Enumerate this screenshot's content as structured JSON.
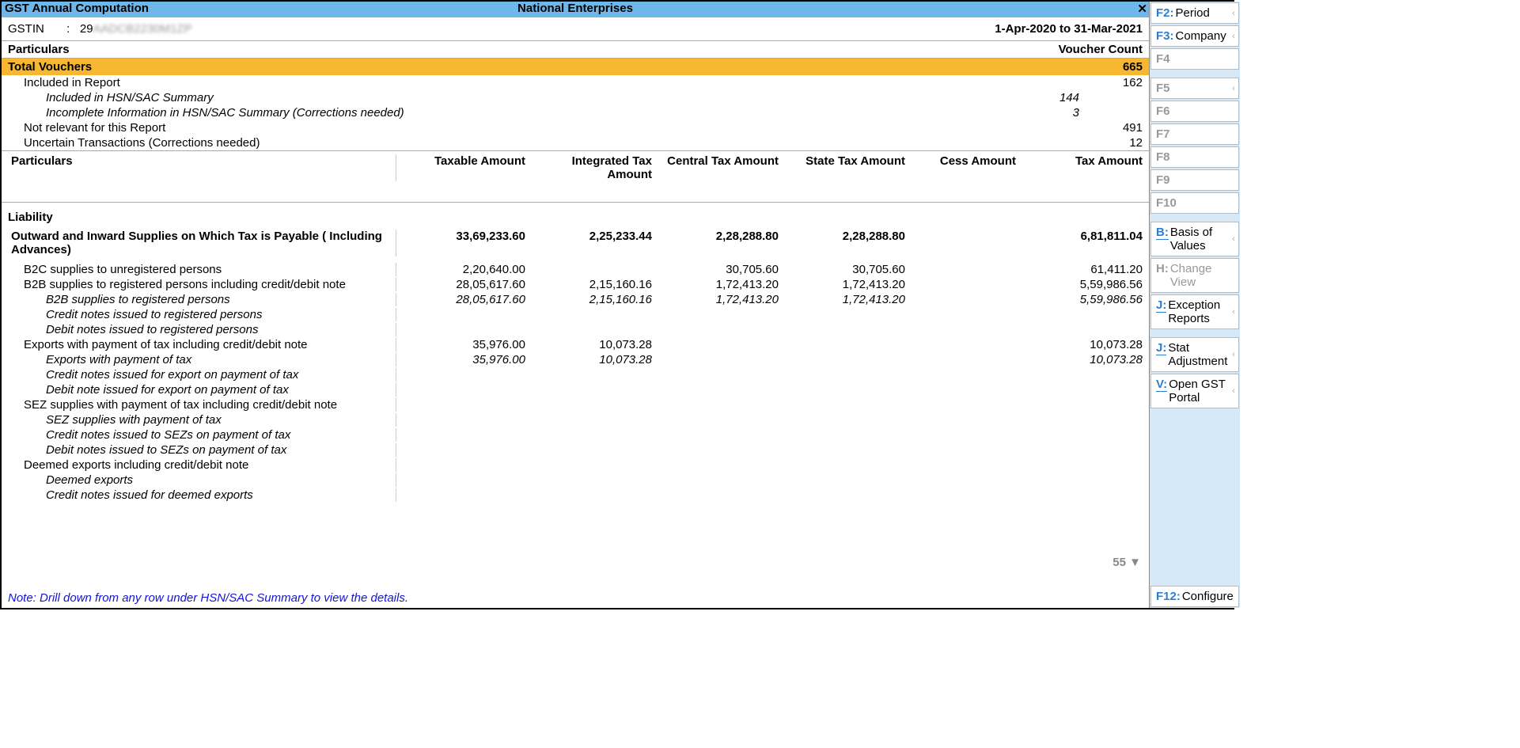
{
  "title_left": "GST Annual Computation",
  "title_center": "National Enterprises",
  "gstin_label": "GSTIN",
  "gstin_sep": ":",
  "gstin_value": "29AADCB2230M1ZP",
  "period": "1-Apr-2020 to 31-Mar-2021",
  "hdr_particulars": "Particulars",
  "hdr_vcount": "Voucher Count",
  "total_vouchers_label": "Total Vouchers",
  "total_vouchers_value": "665",
  "vrows": [
    {
      "label": "Included in Report",
      "mid": "",
      "count": "162",
      "cls": "indent1"
    },
    {
      "label": "Included in HSN/SAC Summary",
      "mid": "144",
      "count": "",
      "cls": "indent2"
    },
    {
      "label": "Incomplete Information in HSN/SAC Summary (Corrections needed)",
      "mid": "3",
      "count": "",
      "cls": "indent2"
    },
    {
      "label": "Not relevant for this Report",
      "mid": "",
      "count": "491",
      "cls": "indent1"
    },
    {
      "label": "Uncertain Transactions (Corrections needed)",
      "mid": "",
      "count": "12",
      "cls": "indent1"
    }
  ],
  "cols": {
    "part": "Particulars",
    "taxable": "Taxable Amount",
    "igst": "Integrated Tax Amount",
    "cgst": "Central Tax Amount",
    "sgst": "State Tax Amount",
    "cess": "Cess Amount",
    "total": "Tax Amount"
  },
  "section": "Liability",
  "data_rows": [
    {
      "label": "Outward and Inward Supplies on Which Tax is Payable ( Including Advances)",
      "taxable": "33,69,233.60",
      "igst": "2,25,233.44",
      "cgst": "2,28,288.80",
      "sgst": "2,28,288.80",
      "cess": "",
      "total": "6,81,811.04",
      "bold": true,
      "indent": 0
    },
    {
      "label": "B2C supplies to unregistered persons",
      "taxable": "2,20,640.00",
      "igst": "",
      "cgst": "30,705.60",
      "sgst": "30,705.60",
      "cess": "",
      "total": "61,411.20",
      "indent": 1
    },
    {
      "label": "B2B supplies to registered persons including credit/debit note",
      "taxable": "28,05,617.60",
      "igst": "2,15,160.16",
      "cgst": "1,72,413.20",
      "sgst": "1,72,413.20",
      "cess": "",
      "total": "5,59,986.56",
      "indent": 1
    },
    {
      "label": "B2B supplies to registered persons",
      "taxable": "28,05,617.60",
      "igst": "2,15,160.16",
      "cgst": "1,72,413.20",
      "sgst": "1,72,413.20",
      "cess": "",
      "total": "5,59,986.56",
      "italic": true,
      "indent": 2
    },
    {
      "label": "Credit notes issued to registered persons",
      "italic": true,
      "indent": 2
    },
    {
      "label": "Debit notes issued to registered persons",
      "italic": true,
      "indent": 2
    },
    {
      "label": "Exports with payment of tax including credit/debit note",
      "taxable": "35,976.00",
      "igst": "10,073.28",
      "cgst": "",
      "sgst": "",
      "cess": "",
      "total": "10,073.28",
      "indent": 1
    },
    {
      "label": "Exports with payment of tax",
      "taxable": "35,976.00",
      "igst": "10,073.28",
      "cgst": "",
      "sgst": "",
      "cess": "",
      "total": "10,073.28",
      "italic": true,
      "indent": 2
    },
    {
      "label": "Credit notes issued for export on payment of tax",
      "italic": true,
      "indent": 2
    },
    {
      "label": "Debit note issued for export on payment of tax",
      "italic": true,
      "indent": 2
    },
    {
      "label": "SEZ supplies with payment of tax including credit/debit note",
      "indent": 1
    },
    {
      "label": "SEZ supplies with payment of tax",
      "italic": true,
      "indent": 2
    },
    {
      "label": "Credit notes issued to SEZs on payment of tax",
      "italic": true,
      "indent": 2
    },
    {
      "label": "Debit notes issued to SEZs on payment of tax",
      "italic": true,
      "indent": 2
    },
    {
      "label": "Deemed exports including credit/debit note",
      "indent": 1
    },
    {
      "label": "Deemed exports",
      "italic": true,
      "indent": 2
    },
    {
      "label": "Credit notes issued for deemed exports",
      "italic": true,
      "indent": 2
    }
  ],
  "scroll_more": "55 ▼",
  "note": "Note: Drill down from any row under HSN/SAC Summary to view the details.",
  "side": {
    "f2": {
      "key": "F2:",
      "label": "Period"
    },
    "f3": {
      "key": "F3:",
      "label": "Company"
    },
    "f4": {
      "key": "F4",
      "label": ""
    },
    "f5": {
      "key": "F5",
      "label": ""
    },
    "f6": {
      "key": "F6",
      "label": ""
    },
    "f7": {
      "key": "F7",
      "label": ""
    },
    "f8": {
      "key": "F8",
      "label": ""
    },
    "f9": {
      "key": "F9",
      "label": ""
    },
    "f10": {
      "key": "F10",
      "label": ""
    },
    "b": {
      "key": "B:",
      "label": "Basis of Values"
    },
    "h": {
      "key": "H:",
      "label": "Change View"
    },
    "j": {
      "key": "J:",
      "label": "Exception Reports"
    },
    "j2": {
      "key": "J:",
      "label": "Stat Adjustment"
    },
    "v": {
      "key": "V:",
      "label": "Open GST Portal"
    },
    "f12": {
      "key": "F12:",
      "label": "Configure"
    }
  }
}
